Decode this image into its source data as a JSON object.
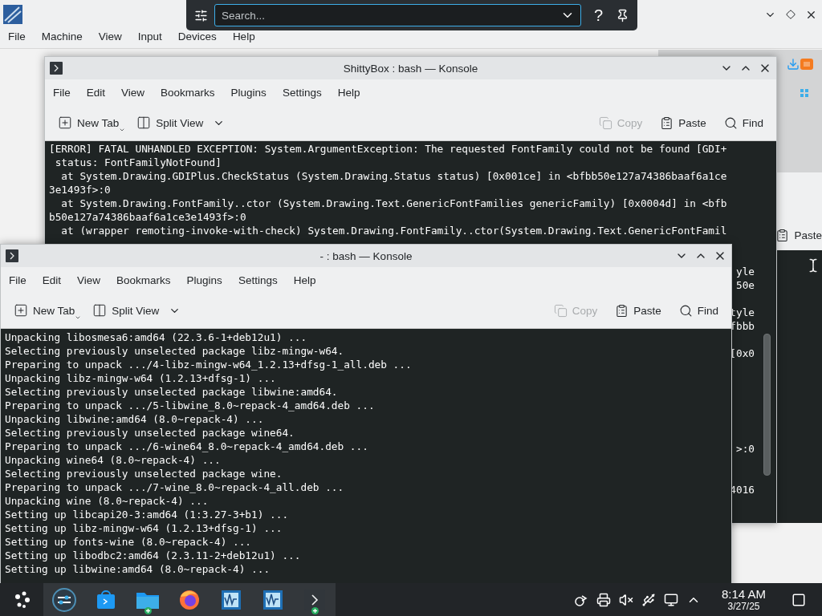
{
  "vbox_window": {
    "menu": [
      "File",
      "Machine",
      "View",
      "Input",
      "Devices",
      "Help"
    ]
  },
  "krunner": {
    "placeholder": "Search...",
    "help": "?"
  },
  "back_window": {
    "paste": "Paste"
  },
  "konsoles": [
    {
      "title": "ShittyBox : bash — Konsole",
      "menu": [
        "File",
        "Edit",
        "View",
        "Bookmarks",
        "Plugins",
        "Settings",
        "Help"
      ],
      "toolbar": {
        "new_tab": "New Tab",
        "split_view": "Split View",
        "copy": {
          "label": "Copy",
          "disabled": true
        },
        "paste": "Paste",
        "find": "Find"
      },
      "lines": [
        "[ERROR] FATAL UNHANDLED EXCEPTION: System.ArgumentException: The requested FontFamily could not be found [GDI+",
        " status: FontFamilyNotFound]",
        "  at System.Drawing.GDIPlus.CheckStatus (System.Drawing.Status status) [0x001ce] in <bfbb50e127a74386baaf6a1ce",
        "3e1493f>:0",
        "  at System.Drawing.FontFamily..ctor (System.Drawing.Text.GenericFontFamilies genericFamily) [0x0004d] in <bfb",
        "b50e127a74386baaf6a1ce3e1493f>:0",
        "  at (wrapper remoting-invoke-with-check) System.Drawing.FontFamily..ctor(System.Drawing.Text.GenericFontFamil"
      ],
      "edge_fragments": [
        "yle",
        "50e",
        "tyle",
        "fbbb",
        "[0x0",
        ">:0",
        "4016"
      ]
    },
    {
      "title": "- : bash — Konsole",
      "menu": [
        "File",
        "Edit",
        "View",
        "Bookmarks",
        "Plugins",
        "Settings",
        "Help"
      ],
      "toolbar": {
        "new_tab": "New Tab",
        "split_view": "Split View",
        "copy": {
          "label": "Copy",
          "disabled": true
        },
        "paste": "Paste",
        "find": "Find"
      },
      "lines": [
        "Unpacking libosmesa6:amd64 (22.3.6-1+deb12u1) ...",
        "Selecting previously unselected package libz-mingw-w64.",
        "Preparing to unpack .../4-libz-mingw-w64_1.2.13+dfsg-1_all.deb ...",
        "Unpacking libz-mingw-w64 (1.2.13+dfsg-1) ...",
        "Selecting previously unselected package libwine:amd64.",
        "Preparing to unpack .../5-libwine_8.0~repack-4_amd64.deb ...",
        "Unpacking libwine:amd64 (8.0~repack-4) ...",
        "Selecting previously unselected package wine64.",
        "Preparing to unpack .../6-wine64_8.0~repack-4_amd64.deb ...",
        "Unpacking wine64 (8.0~repack-4) ...",
        "Selecting previously unselected package wine.",
        "Preparing to unpack .../7-wine_8.0~repack-4_all.deb ...",
        "Unpacking wine (8.0~repack-4) ...",
        "Setting up libcapi20-3:amd64 (1:3.27-3+b1) ...",
        "Setting up libz-mingw-w64 (1.2.13+dfsg-1) ...",
        "Setting up fonts-wine (8.0~repack-4) ...",
        "Setting up libodbc2:amd64 (2.3.11-2+deb12u1) ...",
        "Setting up libwine:amd64 (8.0~repack-4) ..."
      ]
    }
  ],
  "taskbar": {
    "apps": [
      {
        "kind": "launcher",
        "badge": false
      },
      {
        "kind": "settings",
        "badge": false
      },
      {
        "kind": "store",
        "badge": false
      },
      {
        "kind": "folder",
        "badge": true
      },
      {
        "kind": "browser",
        "badge": false
      },
      {
        "kind": "vm",
        "badge": false
      },
      {
        "kind": "vm",
        "badge": false
      },
      {
        "kind": "terminal",
        "badge": true
      }
    ],
    "clock": {
      "time": "8:14 AM",
      "date": "3/27/25"
    }
  }
}
